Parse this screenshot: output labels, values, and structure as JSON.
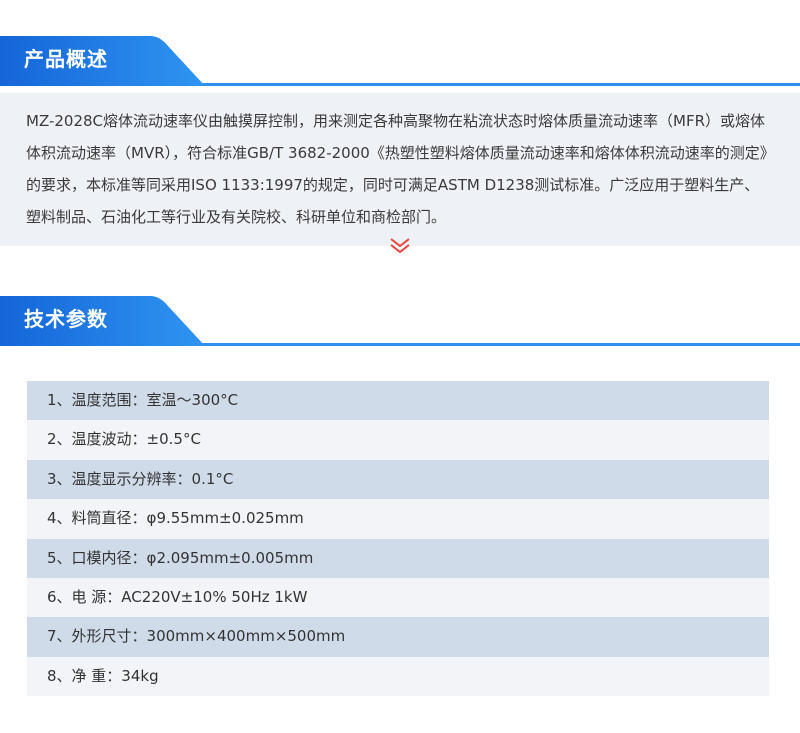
{
  "overview": {
    "title": "产品概述",
    "text": "MZ-2028C熔体流动速率仪由触摸屏控制，用来测定各种高聚物在粘流状态时熔体质量流动速率（MFR）或熔体体积流动速率（MVR），符合标准GB/T 3682-2000《热塑性塑料熔体质量流动速率和熔体体积流动速率的测定》的要求，本标准等同采用ISO 1133:1997的规定，同时可满足ASTM D1238测试标准。广泛应用于塑料生产、塑料制品、石油化工等行业及有关院校、科研单位和商检部门。"
  },
  "params": {
    "title": "技术参数",
    "rows": [
      "1、温度范围：室温～300°C",
      "2、温度波动：±0.5°C",
      "3、温度显示分辨率：0.1°C",
      "4、料筒直径：φ9.55mm±0.025mm",
      "5、口模内径：φ2.095mm±0.005mm",
      "6、电 源：AC220V±10%  50Hz 1kW",
      "7、外形尺寸：300mm×400mm×500mm",
      "8、净 重：34kg"
    ]
  },
  "colors": {
    "accent": "#2f8ff0",
    "header_tab": "#1f78e0",
    "row_odd": "#cfdbe9",
    "row_even": "#f2f4f7",
    "overview_bg": "#eef1f6",
    "chevron": "#e8453c"
  },
  "icons": {
    "expand": "double-chevron-down-icon"
  }
}
